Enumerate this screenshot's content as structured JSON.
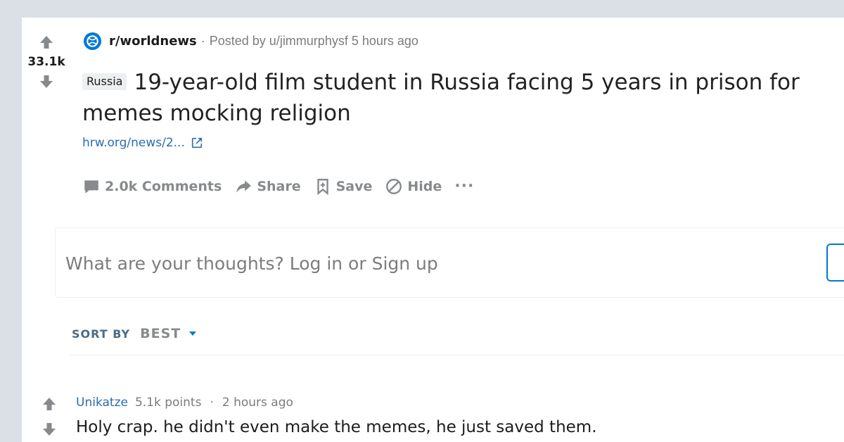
{
  "post": {
    "score": "33.1k",
    "subreddit": "r/worldnews",
    "separator": "·",
    "posted_by": "Posted by u/jimmurphysf 5 hours ago",
    "flair": "Russia",
    "title": "19-year-old film student in Russia facing 5 years in prison for memes mocking religion",
    "link_text": "hrw.org/news/2...",
    "actions": {
      "comments": "2.0k Comments",
      "share": "Share",
      "save": "Save",
      "hide": "Hide",
      "more": "···"
    }
  },
  "comment_box": {
    "placeholder": "What are your thoughts? Log in or Sign up"
  },
  "sort": {
    "label": "SORT BY",
    "value": "BEST"
  },
  "comment": {
    "author": "Unikatze",
    "points": "5.1k points",
    "dot": "·",
    "time": "2 hours ago",
    "body": "Holy crap. he didn't even make the memes, he just saved them."
  },
  "colors": {
    "background": "#dae0e6",
    "card": "#ffffff",
    "link": "#2a6db0",
    "muted": "#878a8c",
    "accent": "#0079d3"
  },
  "icons": [
    "upvote-icon",
    "downvote-icon",
    "subreddit-icon",
    "external-link-icon",
    "comment-icon",
    "share-icon",
    "save-icon",
    "hide-icon",
    "caret-down-icon"
  ]
}
